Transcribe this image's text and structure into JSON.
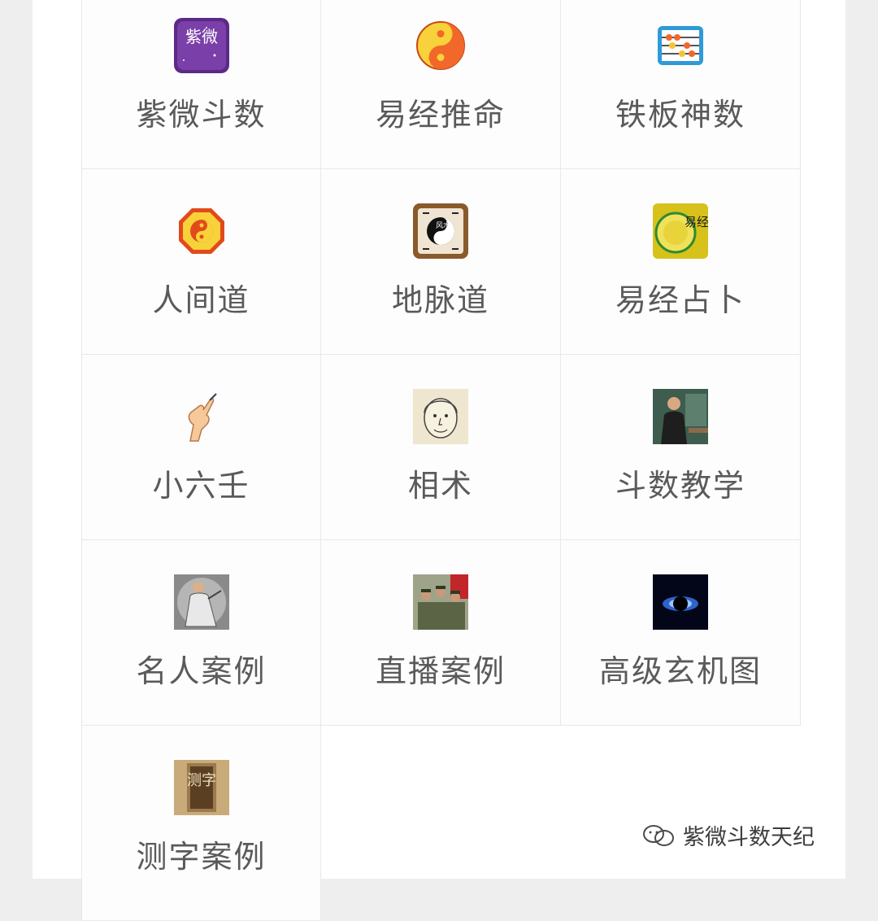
{
  "menu": {
    "items": [
      {
        "label": "紫微斗数",
        "icon": "ziwei-purple-tile-icon",
        "icon_text": "紫微",
        "accent": "#5b2a86"
      },
      {
        "label": "易经推命",
        "icon": "yin-yang-orange-icon",
        "accent": "#f2682a"
      },
      {
        "label": "铁板神数",
        "icon": "abacus-icon",
        "accent": "#2f9ad8"
      },
      {
        "label": "人间道",
        "icon": "bagua-octagon-icon",
        "accent": "#e24a1b"
      },
      {
        "label": "地脉道",
        "icon": "fengshui-bagua-icon",
        "icon_text": "风水",
        "accent": "#8a5a2b"
      },
      {
        "label": "易经占卜",
        "icon": "yijing-gold-disc-icon",
        "icon_text": "易经",
        "accent": "#d6c21a"
      },
      {
        "label": "小六壬",
        "icon": "hand-gesture-icon",
        "accent": "#f2b27a"
      },
      {
        "label": "相术",
        "icon": "face-sketch-icon",
        "accent": "#e8dcc0"
      },
      {
        "label": "斗数教学",
        "icon": "teacher-photo-icon",
        "accent": "#4b6b5a"
      },
      {
        "label": "名人案例",
        "icon": "ink-figure-icon",
        "accent": "#6f6f6f"
      },
      {
        "label": "直播案例",
        "icon": "soldiers-photo-icon",
        "accent": "#6b7250"
      },
      {
        "label": "高级玄机图",
        "icon": "black-hole-icon",
        "accent": "#0a1a4a"
      },
      {
        "label": "测字案例",
        "icon": "cezi-scroll-icon",
        "icon_text": "测字",
        "accent": "#9a7a4e"
      }
    ]
  },
  "watermark": {
    "icon": "wechat-channel-icon",
    "text": "紫微斗数天纪"
  }
}
